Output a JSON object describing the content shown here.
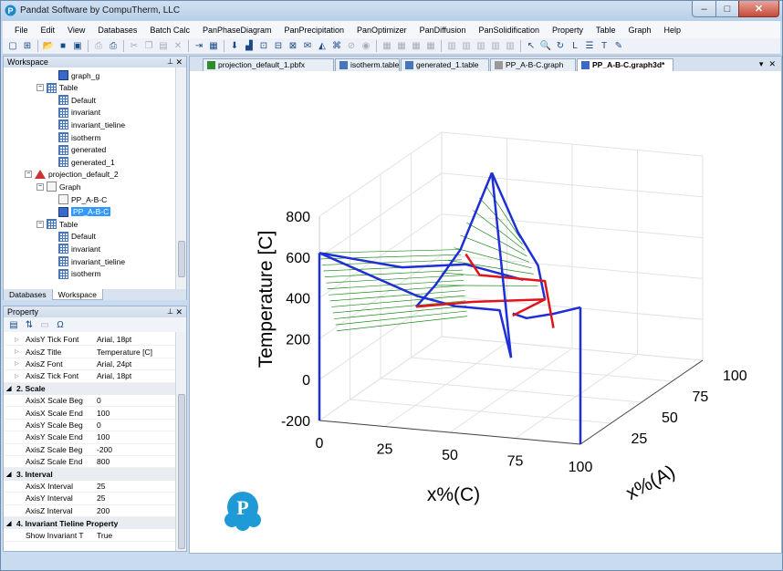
{
  "window": {
    "title": "Pandat Software by CompuTherm, LLC",
    "controls": {
      "minimize": "–",
      "maximize": "□",
      "close": "✕"
    }
  },
  "menu": [
    "File",
    "Edit",
    "View",
    "Databases",
    "Batch Calc",
    "PanPhaseDiagram",
    "PanPrecipitation",
    "PanOptimizer",
    "PanDiffusion",
    "PanSolidification",
    "Property",
    "Table",
    "Graph",
    "Help"
  ],
  "workspace": {
    "header": "Workspace",
    "tree": [
      {
        "label": "graph_g",
        "level": 3,
        "icon": "3d-graph-icon"
      },
      {
        "label": "Table",
        "level": 2,
        "icon": "table-icon",
        "expander": "−"
      },
      {
        "label": "Default",
        "level": 3,
        "icon": "table-icon"
      },
      {
        "label": "invariant",
        "level": 3,
        "icon": "table-icon"
      },
      {
        "label": "invariant_tieline",
        "level": 3,
        "icon": "table-icon"
      },
      {
        "label": "isotherm",
        "level": 3,
        "icon": "table-icon"
      },
      {
        "label": "generated",
        "level": 3,
        "icon": "table-icon"
      },
      {
        "label": "generated_1",
        "level": 3,
        "icon": "table-icon"
      },
      {
        "label": "projection_default_2",
        "level": 1,
        "icon": "projection-icon",
        "expander": "−"
      },
      {
        "label": "Graph",
        "level": 2,
        "icon": "graph-icon",
        "expander": "−"
      },
      {
        "label": "PP_A-B-C",
        "level": 3,
        "icon": "graph-icon"
      },
      {
        "label": "PP_A-B-C",
        "level": 3,
        "icon": "3d-graph-icon",
        "selected": true
      },
      {
        "label": "Table",
        "level": 2,
        "icon": "table-icon",
        "expander": "−"
      },
      {
        "label": "Default",
        "level": 3,
        "icon": "table-icon"
      },
      {
        "label": "invariant",
        "level": 3,
        "icon": "table-icon"
      },
      {
        "label": "invariant_tieline",
        "level": 3,
        "icon": "table-icon"
      },
      {
        "label": "isotherm",
        "level": 3,
        "icon": "table-icon"
      }
    ],
    "tabs": [
      "Databases",
      "Workspace"
    ]
  },
  "property": {
    "header": "Property",
    "rows": [
      {
        "key": "AxisY Tick Font",
        "value": "Arial, 18pt"
      },
      {
        "key": "AxisZ Title",
        "value": "Temperature [C]"
      },
      {
        "key": "AxisZ Font",
        "value": "Arial, 24pt"
      },
      {
        "key": "AxisZ Tick Font",
        "value": "Arial, 18pt"
      },
      {
        "category": "2. Scale"
      },
      {
        "key": "AxisX Scale Beg",
        "value": "0"
      },
      {
        "key": "AxisX Scale End",
        "value": "100"
      },
      {
        "key": "AxisY Scale Beg",
        "value": "0"
      },
      {
        "key": "AxisY Scale End",
        "value": "100"
      },
      {
        "key": "AxisZ Scale Beg",
        "value": "-200"
      },
      {
        "key": "AxisZ Scale End",
        "value": "800"
      },
      {
        "category": "3. Interval"
      },
      {
        "key": "AxisX Interval",
        "value": "25"
      },
      {
        "key": "AxisY Interval",
        "value": "25"
      },
      {
        "key": "AxisZ Interval",
        "value": "200"
      },
      {
        "category": "4. Invariant Tieline Property"
      },
      {
        "key": "Show Invariant T",
        "value": "True"
      }
    ]
  },
  "doc_tabs": [
    {
      "label": "projection_default_1.pbfx",
      "icon": "down-arrow-icon"
    },
    {
      "label": "isotherm.table",
      "icon": "table-icon"
    },
    {
      "label": "generated_1.table",
      "icon": "table-icon"
    },
    {
      "label": "PP_A-B-C.graph",
      "icon": "graph-icon"
    },
    {
      "label": "PP_A-B-C.graph3d*",
      "icon": "3d-graph-icon",
      "active": true
    }
  ],
  "doc_controls": {
    "dropdown": "▾",
    "close": "✕"
  },
  "chart_data": {
    "type": "3d-line",
    "zlabel": "Temperature [C]",
    "xlabel": "x%(C)",
    "ylabel": "x%(A)",
    "x_ticks": [
      "0",
      "25",
      "50",
      "75",
      "100"
    ],
    "y_ticks": [
      "25",
      "50",
      "75",
      "100"
    ],
    "z_ticks": [
      "-200",
      "0",
      "200",
      "400",
      "600",
      "800"
    ],
    "xlim": [
      0,
      100
    ],
    "ylim": [
      0,
      100
    ],
    "zlim": [
      -200,
      800
    ],
    "x_interval": 25,
    "y_interval": 25,
    "z_interval": 200,
    "colors": {
      "liquidus": "#1f2fd6",
      "invariant": "#e0141c",
      "tieline": "#1a8a1a"
    },
    "series": [
      {
        "name": "",
        "color": "#1f2fd6",
        "points": [
          [
            0,
            0,
            620
          ],
          [
            35,
            5,
            430
          ],
          [
            45,
            15,
            350
          ],
          [
            55,
            30,
            280
          ],
          [
            50,
            50,
            -40
          ]
        ]
      },
      {
        "name": "",
        "color": "#1f2fd6",
        "points": [
          [
            0,
            0,
            620
          ],
          [
            20,
            25,
            470
          ],
          [
            35,
            45,
            420
          ],
          [
            50,
            60,
            300
          ]
        ]
      },
      {
        "name": "",
        "color": "#1f2fd6",
        "points": [
          [
            45,
            45,
            880
          ],
          [
            40,
            30,
            560
          ],
          [
            35,
            20,
            420
          ],
          [
            30,
            15,
            330
          ]
        ]
      },
      {
        "name": "",
        "color": "#1f2fd6",
        "points": [
          [
            45,
            45,
            880
          ],
          [
            55,
            45,
            600
          ],
          [
            65,
            40,
            470
          ],
          [
            70,
            35,
            330
          ]
        ]
      },
      {
        "name": "",
        "color": "#1f2fd6",
        "points": [
          [
            100,
            0,
            470
          ],
          [
            85,
            10,
            380
          ],
          [
            70,
            20,
            300
          ],
          [
            60,
            30,
            270
          ]
        ]
      },
      {
        "name": "",
        "color": "#e0141c",
        "points": [
          [
            30,
            15,
            330
          ],
          [
            45,
            30,
            310
          ],
          [
            70,
            35,
            330
          ],
          [
            60,
            30,
            260
          ]
        ]
      },
      {
        "name": "",
        "color": "#e0141c",
        "points": [
          [
            35,
            45,
            470
          ],
          [
            45,
            35,
            420
          ],
          [
            70,
            35,
            420
          ],
          [
            85,
            10,
            310
          ]
        ]
      }
    ]
  },
  "logo": {
    "letter": "P"
  }
}
